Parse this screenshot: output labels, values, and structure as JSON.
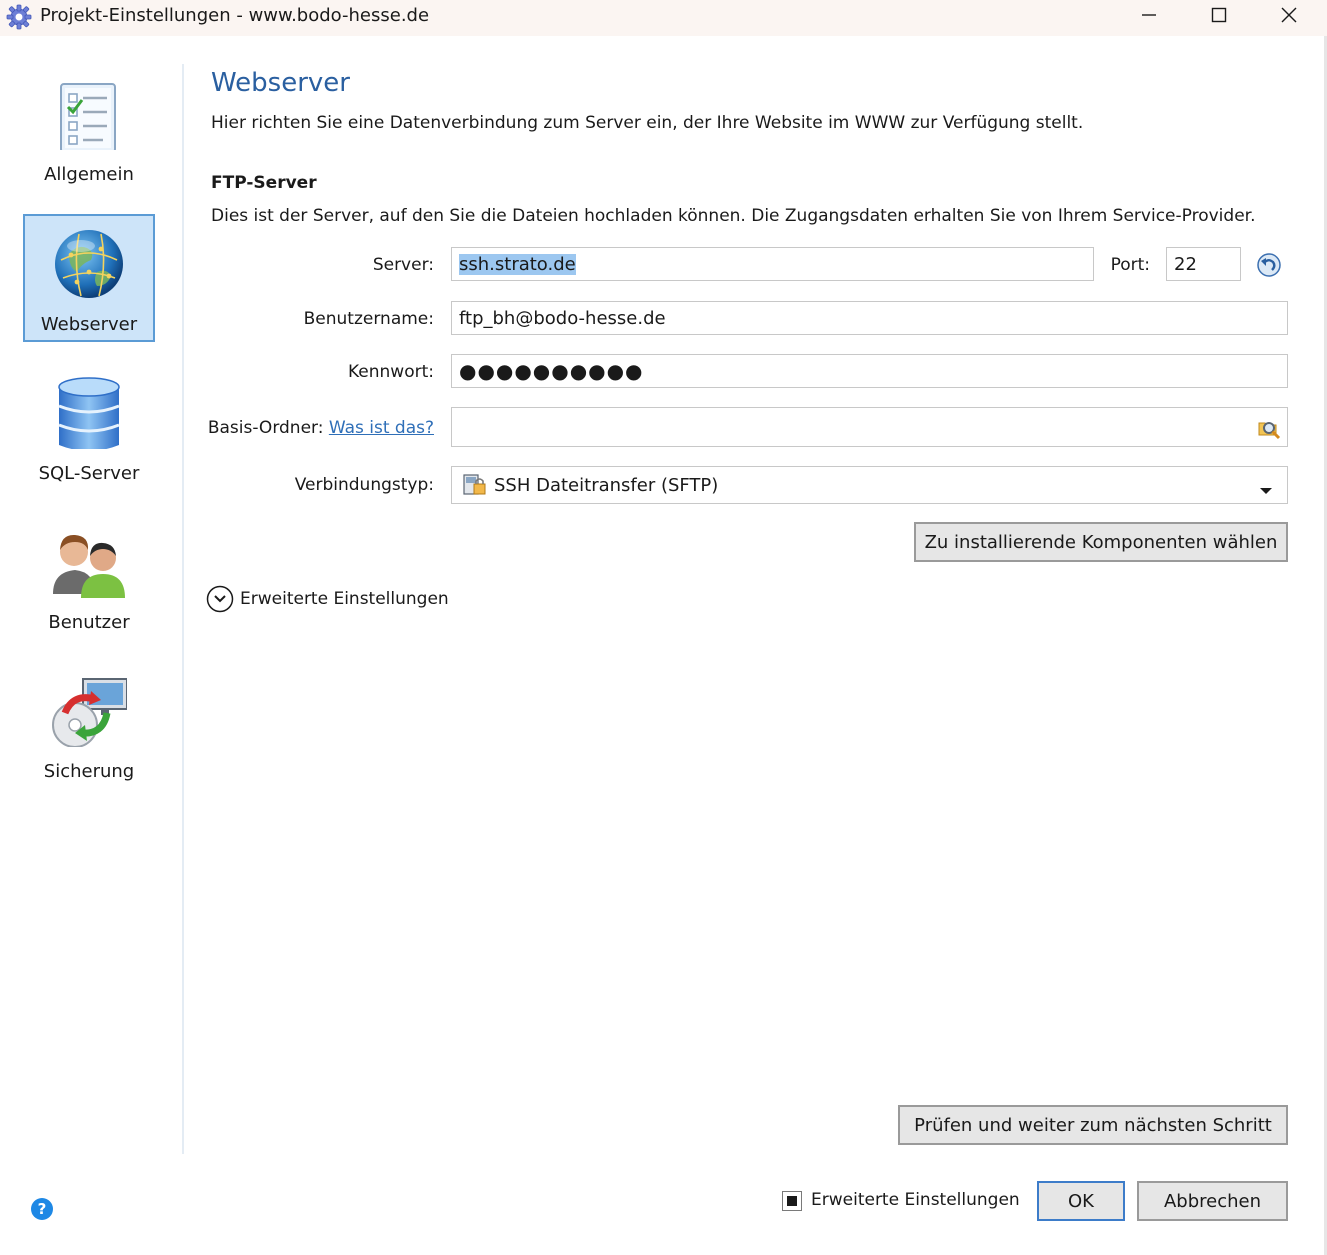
{
  "window": {
    "title": "Projekt-Einstellungen - www.bodo-hesse.de",
    "minimize_icon": "minimize-icon",
    "maximize_icon": "maximize-icon",
    "close_icon": "close-icon"
  },
  "sidebar": {
    "items": [
      {
        "label": "Allgemein",
        "icon": "checklist-icon",
        "active": false
      },
      {
        "label": "Webserver",
        "icon": "globe-icon",
        "active": true
      },
      {
        "label": "SQL-Server",
        "icon": "database-icon",
        "active": false
      },
      {
        "label": "Benutzer",
        "icon": "users-icon",
        "active": false
      },
      {
        "label": "Sicherung",
        "icon": "backup-icon",
        "active": false
      }
    ]
  },
  "main": {
    "heading": "Webserver",
    "subtitle": "Hier richten Sie eine Datenverbindung zum Server ein, der Ihre Website im WWW zur Verfügung stellt.",
    "section_title": "FTP-Server",
    "section_desc": "Dies ist der Server, auf den Sie die Dateien hochladen können. Die Zugangsdaten erhalten Sie von Ihrem Service-Provider.",
    "server_label": "Server:",
    "server_value": "ssh.strato.de",
    "port_label": "Port:",
    "port_value": "22",
    "benutzername_label": "Benutzername:",
    "benutzername_value": "ftp_bh@bodo-hesse.de",
    "kennwort_label": "Kennwort:",
    "kennwort_value": "●●●●●●●●●●",
    "basis_label": "Basis-Ordner:",
    "basis_link": "Was ist das?",
    "basis_value": "",
    "verbindungstyp_label": "Verbindungstyp:",
    "verbindungstyp_value": "SSH Dateitransfer (SFTP)",
    "komponenten_button": "Zu installierende Komponenten wählen",
    "erweitert_toggle": "Erweiterte Einstellungen",
    "pruefen_button": "Prüfen und weiter zum nächsten Schritt"
  },
  "footer": {
    "erweitert_checkbox_label": "Erweiterte Einstellungen",
    "ok_button": "OK",
    "cancel_button": "Abbrechen"
  },
  "colors": {
    "accent": "#2a5fa0",
    "selection": "#9cc7f0",
    "active_nav_bg": "#cde4f9",
    "active_nav_border": "#5b9bd5",
    "link": "#2f6fb8",
    "help": "#1e88e5"
  }
}
